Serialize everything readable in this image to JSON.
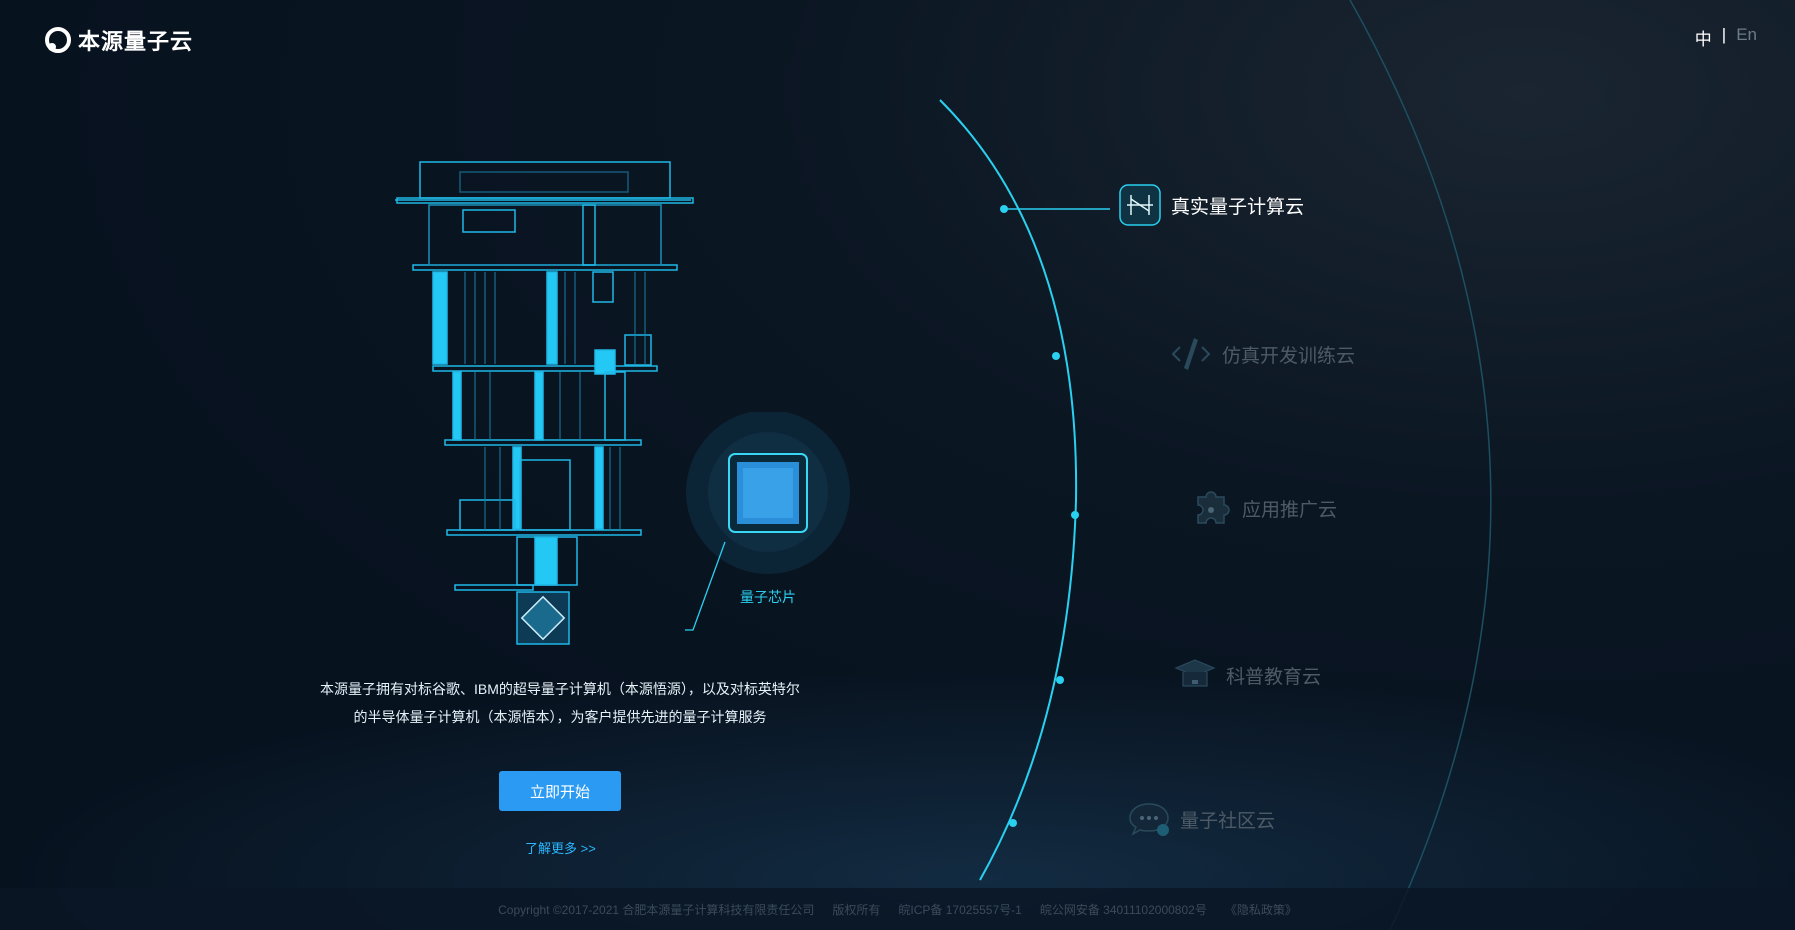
{
  "brand": {
    "name": "本源量子云"
  },
  "language": {
    "zh": "中",
    "separator": "|",
    "en": "En"
  },
  "hero": {
    "chip_label": "量子芯片",
    "description_line1": "本源量子拥有对标谷歌、IBM的超导量子计算机（本源悟源），以及对标英特尔",
    "description_line2": "的半导体量子计算机（本源悟本），为客户提供先进的量子计算服务",
    "start_button": "立即开始",
    "learn_more": "了解更多 >>"
  },
  "nav": [
    {
      "label": "真实量子计算云",
      "icon": "circuit-icon",
      "active": true
    },
    {
      "label": "仿真开发训练云",
      "icon": "code-icon",
      "active": false
    },
    {
      "label": "应用推广云",
      "icon": "puzzle-icon",
      "active": false
    },
    {
      "label": "科普教育云",
      "icon": "graduation-cap-icon",
      "active": false
    },
    {
      "label": "量子社区云",
      "icon": "chat-bubble-icon",
      "active": false
    }
  ],
  "footer": {
    "copyright": "Copyright ©2017-2021 合肥本源量子计算科技有限责任公司",
    "rights": "版权所有",
    "icp": "皖ICP备 17025557号-1",
    "police": "皖公网安备 34011102000802号",
    "privacy": "《隐私政策》"
  },
  "colors": {
    "accent": "#2ad0f0",
    "button": "#2b9af3",
    "background": "#07121f"
  }
}
